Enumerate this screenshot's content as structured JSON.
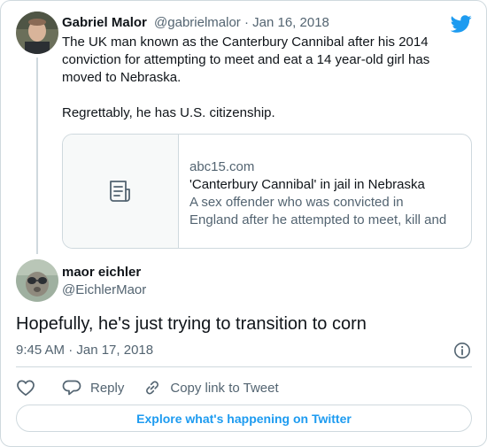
{
  "parent_tweet": {
    "display_name": "Gabriel Malor",
    "handle": "@gabrielmalor",
    "separator": " · ",
    "date": "Jan 16, 2018",
    "paragraphs": [
      "The UK man known as the Canterbury Cannibal after his 2014 conviction for attempting to meet and eat a 14 year-old girl has moved to Nebraska.",
      "Regrettably, he has U.S. citizenship."
    ],
    "link_card": {
      "domain": "abc15.com",
      "title": "'Canterbury Cannibal' in jail in Nebraska",
      "description": "A sex offender who was convicted in England after he attempted to meet, kill and eat a …",
      "icon": "document-icon"
    }
  },
  "reply_tweet": {
    "display_name": "maor eichler",
    "handle": "@EichlerMaor",
    "text": "Hopefully, he's just trying to transition to corn",
    "timestamp": "9:45 AM · Jan 17, 2018"
  },
  "actions": {
    "reply_label": "Reply",
    "copy_label": "Copy link to Tweet"
  },
  "explore_button": "Explore what's happening on Twitter",
  "colors": {
    "twitter_blue": "#1d9bf0",
    "text_primary": "#0f1419",
    "text_secondary": "#536471",
    "border": "#cfd9de"
  },
  "icons": [
    "twitter-logo-icon",
    "document-icon",
    "info-icon",
    "heart-icon",
    "reply-icon",
    "link-icon"
  ]
}
